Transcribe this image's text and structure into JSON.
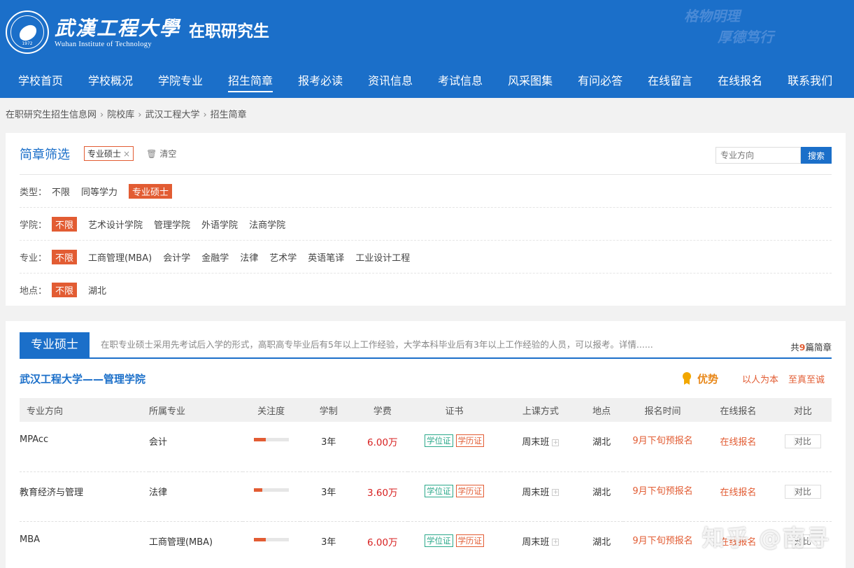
{
  "header": {
    "school_cn": "武漢工程大學",
    "school_en": "Wuhan Institute of Technology",
    "seal_year": "1972",
    "site_title": "在职研究生",
    "motto": [
      "格物明理",
      "厚德笃行"
    ]
  },
  "nav": {
    "items": [
      "学校首页",
      "学校概况",
      "学院专业",
      "招生简章",
      "报考必读",
      "资讯信息",
      "考试信息",
      "风采图集",
      "有问必答",
      "在线留言",
      "在线报名",
      "联系我们"
    ],
    "active": "招生简章"
  },
  "breadcrumb": [
    "在职研究生招生信息网",
    "院校库",
    "武汉工程大学",
    "招生简章"
  ],
  "filter": {
    "title": "简章筛选",
    "chip": "专业硕士",
    "clear_label": "清空",
    "search_placeholder": "专业方向",
    "search_button": "搜索",
    "rows": [
      {
        "label": "类型：",
        "options": [
          "不限",
          "同等学力",
          "专业硕士"
        ],
        "selected": 2
      },
      {
        "label": "学院：",
        "options": [
          "不限",
          "艺术设计学院",
          "管理学院",
          "外语学院",
          "法商学院"
        ],
        "selected": 0
      },
      {
        "label": "专业：",
        "options": [
          "不限",
          "工商管理(MBA)",
          "会计学",
          "金融学",
          "法律",
          "艺术学",
          "英语笔译",
          "工业设计工程"
        ],
        "selected": 0
      },
      {
        "label": "地点：",
        "options": [
          "不限",
          "湖北"
        ],
        "selected": 0
      }
    ]
  },
  "list": {
    "tab": "专业硕士",
    "description": "在职专业硕士采用先考试后入学的形式，高职高专毕业后有5年以上工作经验，大学本科毕业后有3年以上工作经验的人员，可以报考。详情......",
    "total_prefix": "共",
    "total_count": "9",
    "total_suffix": "篇简章",
    "school_name": "武汉工程大学——管理学院",
    "advantage_title": "优势",
    "advantage_tags": [
      "以人为本",
      "至真至诚"
    ],
    "headers": [
      "专业方向",
      "所属专业",
      "关注度",
      "学制",
      "学费",
      "证书",
      "上课方式",
      "地点",
      "报名时间",
      "在线报名",
      "对比"
    ],
    "rows": [
      {
        "direction": "MPAcc",
        "major": "会计",
        "attention": 0.35,
        "duration": "3年",
        "fee": "6.00万",
        "cert1": "学位证",
        "cert2": "学历证",
        "mode": "周末班",
        "location": "湖北",
        "reg_time": "9月下旬预报名",
        "apply": "在线报名",
        "compare": "对比"
      },
      {
        "direction": "教育经济与管理",
        "major": "法律",
        "attention": 0.25,
        "duration": "3年",
        "fee": "3.60万",
        "cert1": "学位证",
        "cert2": "学历证",
        "mode": "周末班",
        "location": "湖北",
        "reg_time": "9月下旬预报名",
        "apply": "在线报名",
        "compare": "对比"
      },
      {
        "direction": "MBA",
        "major": "工商管理(MBA)",
        "attention": 0.35,
        "duration": "3年",
        "fee": "6.00万",
        "cert1": "学位证",
        "cert2": "学历证",
        "mode": "周末班",
        "location": "湖北",
        "reg_time": "9月下旬预报名",
        "apply": "在线报名",
        "compare": "对比"
      }
    ]
  },
  "watermark": "知乎 @南寻",
  "colors": {
    "primary": "#1b6fc9",
    "accent": "#e25c33",
    "fee": "#d71f1f",
    "cert_green": "#2aa88a"
  },
  "icons": {
    "seal": "school-seal-icon",
    "clear": "trash-icon",
    "advantage": "medal-icon",
    "plus": "plus-icon"
  }
}
